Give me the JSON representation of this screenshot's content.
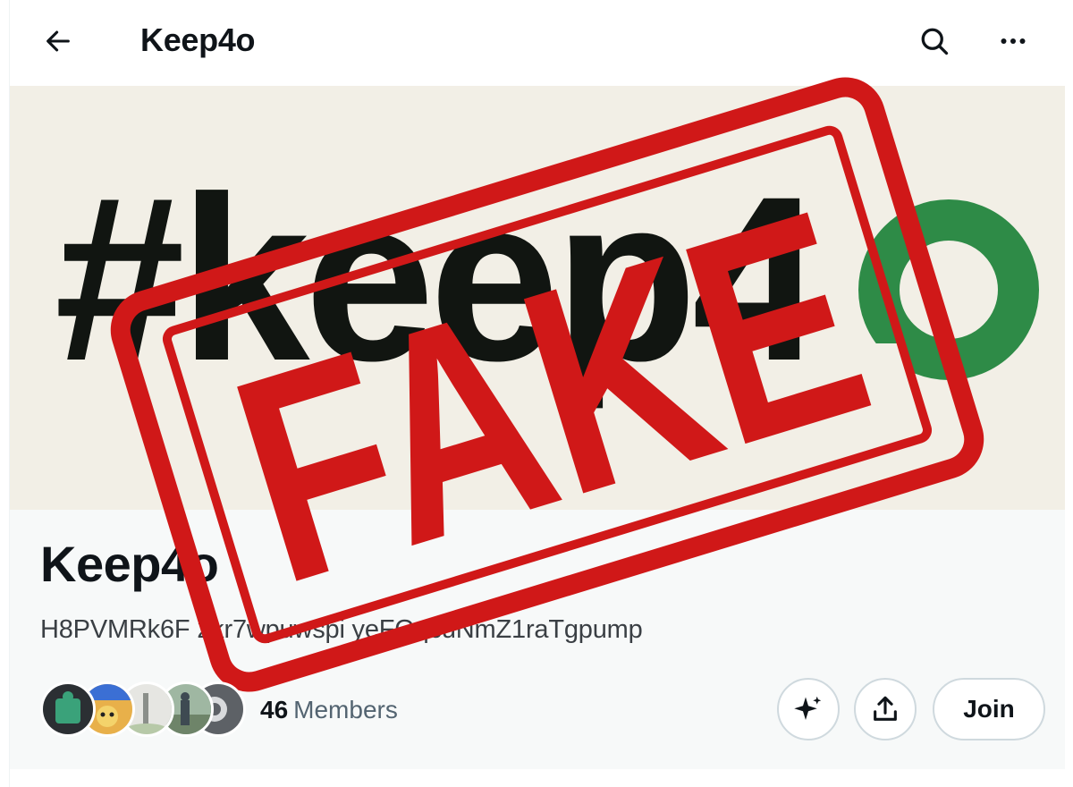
{
  "header": {
    "title": "Keep4o",
    "back_icon": "arrow-left-icon",
    "search_icon": "search-icon",
    "more_icon": "more-horizontal-icon"
  },
  "banner": {
    "hashtag_text": "#keep4",
    "logo_color": "#2e8b47",
    "text_color": "#111511",
    "background": "#f2efe6"
  },
  "community": {
    "name": "Keep4o",
    "description": "H8PVMRk6F  2kr7wpuwspi   yeFGqcuNmZ1raTgpump",
    "member_count": "46",
    "members_label": "Members",
    "avatars": [
      "avatar-1",
      "avatar-2",
      "avatar-3",
      "avatar-4",
      "avatar-5"
    ]
  },
  "actions": {
    "grok_icon": "sparkle-icon",
    "share_icon": "share-icon",
    "join_label": "Join"
  },
  "overlay": {
    "stamp_text": "FAKE",
    "stamp_color": "#d01818"
  }
}
